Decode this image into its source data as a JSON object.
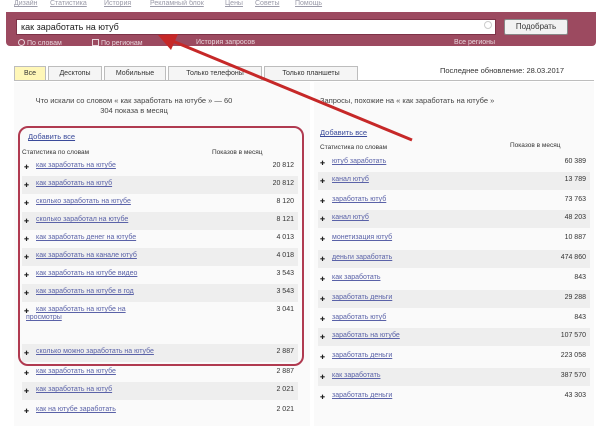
{
  "topnav": [
    "Дизайн",
    "Статистика",
    "История",
    "Рекламный блок",
    "Цены",
    "Советы",
    "Помощь"
  ],
  "search": {
    "value": "как заработать на ютуб",
    "button_label": "Подобрать",
    "options": [
      "По словам",
      "По регионам",
      "История запросов",
      "Все регионы"
    ]
  },
  "tabs": [
    {
      "label": "Все",
      "active": true
    },
    {
      "label": "Десктопы",
      "active": false
    },
    {
      "label": "Мобильные",
      "active": false
    },
    {
      "label": "Только телефоны",
      "active": false
    },
    {
      "label": "Только планшеты",
      "active": false
    }
  ],
  "updated": "Последнее обновление: 28.03.2017",
  "left": {
    "heading": "Что искали со словом « как заработать на ютубе » — 60 304 показа в месяц",
    "add_all": "Добавить все",
    "col_phrase": "Статистика по словам",
    "col_count": "Показов в месяц",
    "rows": [
      {
        "phrase": "как заработать на ютубе",
        "count": "20 812"
      },
      {
        "phrase": "как заработать на ютуб",
        "count": "20 812"
      },
      {
        "phrase": "сколько заработать на ютубе",
        "count": "8 120"
      },
      {
        "phrase": "сколько заработал на ютубе",
        "count": "8 121"
      },
      {
        "phrase": "как заработать денег на ютубе",
        "count": "4 013"
      },
      {
        "phrase": "как заработать на канале ютуб",
        "count": "4 018"
      },
      {
        "phrase": "как заработать на ютубе видео",
        "count": "3 543"
      },
      {
        "phrase": "как заработать на ютубе в год",
        "count": "3 543"
      },
      {
        "phrase": "как заработать на ютубе на",
        "phrase2": "просмотры",
        "count": "3 041"
      },
      {
        "phrase": "сколько можно заработать на ютубе",
        "count": "2 887"
      },
      {
        "phrase": "как заработать на ютубе",
        "count": "2 887"
      },
      {
        "phrase": "как заработать на ютуб",
        "count": "2 021"
      },
      {
        "phrase": "как на ютубе заработать",
        "count": "2 021"
      }
    ]
  },
  "right": {
    "heading": "Запросы, похожие на « как заработать на ютубе »",
    "add_all": "Добавить все",
    "col_phrase": "Статистика по словам",
    "col_count": "Показов в месяц",
    "rows": [
      {
        "phrase": "ютуб заработать",
        "count": "60 389"
      },
      {
        "phrase": "канал ютуб",
        "count": "13 789"
      },
      {
        "phrase": "заработать ютуб",
        "count": "73 763"
      },
      {
        "phrase": "канал ютуб",
        "count": "48 203"
      },
      {
        "phrase": "монетизация ютуб",
        "count": "10 887"
      },
      {
        "phrase": "деньги заработать",
        "count": "474 860"
      },
      {
        "phrase": "как заработать",
        "count": "843"
      },
      {
        "phrase": "заработать деньги",
        "count": "29 288"
      },
      {
        "phrase": "заработать ютуб",
        "count": "843"
      },
      {
        "phrase": "заработать на ютубе",
        "count": "107 570"
      },
      {
        "phrase": "заработать деньги",
        "count": "223 058"
      },
      {
        "phrase": "как заработать",
        "count": "387 570"
      },
      {
        "phrase": "заработать деньги",
        "count": "43 303"
      }
    ]
  }
}
